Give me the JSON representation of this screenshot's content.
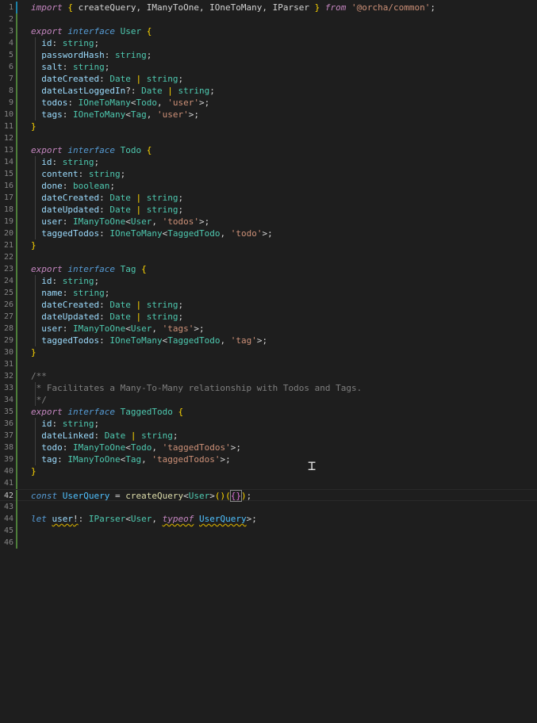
{
  "lines": [
    {
      "n": "1",
      "tokens": [
        [
          "kw",
          "import"
        ],
        [
          "op",
          " "
        ],
        [
          "br1",
          "{"
        ],
        [
          "op",
          " createQuery, IManyToOne, IOneToMany, IParser "
        ],
        [
          "br1",
          "}"
        ],
        [
          "op",
          " "
        ],
        [
          "kw",
          "from"
        ],
        [
          "op",
          " "
        ],
        [
          "str",
          "'@orcha/common'"
        ],
        [
          "op",
          ";"
        ]
      ]
    },
    {
      "n": "2",
      "tokens": []
    },
    {
      "n": "3",
      "tokens": [
        [
          "kw",
          "export"
        ],
        [
          "op",
          " "
        ],
        [
          "st",
          "interface"
        ],
        [
          "op",
          " "
        ],
        [
          "tp",
          "User"
        ],
        [
          "op",
          " "
        ],
        [
          "br1",
          "{"
        ]
      ]
    },
    {
      "n": "4",
      "tokens": [
        [
          "op",
          "  "
        ],
        [
          "pr",
          "id"
        ],
        [
          "op",
          ": "
        ],
        [
          "tp",
          "string"
        ],
        [
          "op",
          ";"
        ]
      ]
    },
    {
      "n": "5",
      "tokens": [
        [
          "op",
          "  "
        ],
        [
          "pr",
          "passwordHash"
        ],
        [
          "op",
          ": "
        ],
        [
          "tp",
          "string"
        ],
        [
          "op",
          ";"
        ]
      ]
    },
    {
      "n": "6",
      "tokens": [
        [
          "op",
          "  "
        ],
        [
          "pr",
          "salt"
        ],
        [
          "op",
          ": "
        ],
        [
          "tp",
          "string"
        ],
        [
          "op",
          ";"
        ]
      ]
    },
    {
      "n": "7",
      "tokens": [
        [
          "op",
          "  "
        ],
        [
          "pr",
          "dateCreated"
        ],
        [
          "op",
          ": "
        ],
        [
          "tp",
          "Date"
        ],
        [
          "op",
          " "
        ],
        [
          "bar",
          "|"
        ],
        [
          "op",
          " "
        ],
        [
          "tp",
          "string"
        ],
        [
          "op",
          ";"
        ]
      ]
    },
    {
      "n": "8",
      "tokens": [
        [
          "op",
          "  "
        ],
        [
          "pr",
          "dateLastLoggedIn"
        ],
        [
          "op",
          "?: "
        ],
        [
          "tp",
          "Date"
        ],
        [
          "op",
          " "
        ],
        [
          "bar",
          "|"
        ],
        [
          "op",
          " "
        ],
        [
          "tp",
          "string"
        ],
        [
          "op",
          ";"
        ]
      ]
    },
    {
      "n": "9",
      "tokens": [
        [
          "op",
          "  "
        ],
        [
          "pr",
          "todos"
        ],
        [
          "op",
          ": "
        ],
        [
          "tp",
          "IOneToMany"
        ],
        [
          "op",
          "<"
        ],
        [
          "tp",
          "Todo"
        ],
        [
          "op",
          ", "
        ],
        [
          "str",
          "'user'"
        ],
        [
          "op",
          ">;"
        ]
      ]
    },
    {
      "n": "10",
      "tokens": [
        [
          "op",
          "  "
        ],
        [
          "pr",
          "tags"
        ],
        [
          "op",
          ": "
        ],
        [
          "tp",
          "IOneToMany"
        ],
        [
          "op",
          "<"
        ],
        [
          "tp",
          "Tag"
        ],
        [
          "op",
          ", "
        ],
        [
          "str",
          "'user'"
        ],
        [
          "op",
          ">;"
        ]
      ]
    },
    {
      "n": "11",
      "tokens": [
        [
          "br1",
          "}"
        ]
      ]
    },
    {
      "n": "12",
      "tokens": []
    },
    {
      "n": "13",
      "tokens": [
        [
          "kw",
          "export"
        ],
        [
          "op",
          " "
        ],
        [
          "st",
          "interface"
        ],
        [
          "op",
          " "
        ],
        [
          "tp",
          "Todo"
        ],
        [
          "op",
          " "
        ],
        [
          "br1",
          "{"
        ]
      ]
    },
    {
      "n": "14",
      "tokens": [
        [
          "op",
          "  "
        ],
        [
          "pr",
          "id"
        ],
        [
          "op",
          ": "
        ],
        [
          "tp",
          "string"
        ],
        [
          "op",
          ";"
        ]
      ]
    },
    {
      "n": "15",
      "tokens": [
        [
          "op",
          "  "
        ],
        [
          "pr",
          "content"
        ],
        [
          "op",
          ": "
        ],
        [
          "tp",
          "string"
        ],
        [
          "op",
          ";"
        ]
      ]
    },
    {
      "n": "16",
      "tokens": [
        [
          "op",
          "  "
        ],
        [
          "pr",
          "done"
        ],
        [
          "op",
          ": "
        ],
        [
          "tp",
          "boolean"
        ],
        [
          "op",
          ";"
        ]
      ]
    },
    {
      "n": "17",
      "tokens": [
        [
          "op",
          "  "
        ],
        [
          "pr",
          "dateCreated"
        ],
        [
          "op",
          ": "
        ],
        [
          "tp",
          "Date"
        ],
        [
          "op",
          " "
        ],
        [
          "bar",
          "|"
        ],
        [
          "op",
          " "
        ],
        [
          "tp",
          "string"
        ],
        [
          "op",
          ";"
        ]
      ]
    },
    {
      "n": "18",
      "tokens": [
        [
          "op",
          "  "
        ],
        [
          "pr",
          "dateUpdated"
        ],
        [
          "op",
          ": "
        ],
        [
          "tp",
          "Date"
        ],
        [
          "op",
          " "
        ],
        [
          "bar",
          "|"
        ],
        [
          "op",
          " "
        ],
        [
          "tp",
          "string"
        ],
        [
          "op",
          ";"
        ]
      ]
    },
    {
      "n": "19",
      "tokens": [
        [
          "op",
          "  "
        ],
        [
          "pr",
          "user"
        ],
        [
          "op",
          ": "
        ],
        [
          "tp",
          "IManyToOne"
        ],
        [
          "op",
          "<"
        ],
        [
          "tp",
          "User"
        ],
        [
          "op",
          ", "
        ],
        [
          "str",
          "'todos'"
        ],
        [
          "op",
          ">;"
        ]
      ]
    },
    {
      "n": "20",
      "tokens": [
        [
          "op",
          "  "
        ],
        [
          "pr",
          "taggedTodos"
        ],
        [
          "op",
          ": "
        ],
        [
          "tp",
          "IOneToMany"
        ],
        [
          "op",
          "<"
        ],
        [
          "tp",
          "TaggedTodo"
        ],
        [
          "op",
          ", "
        ],
        [
          "str",
          "'todo'"
        ],
        [
          "op",
          ">;"
        ]
      ]
    },
    {
      "n": "21",
      "tokens": [
        [
          "br1",
          "}"
        ]
      ]
    },
    {
      "n": "22",
      "tokens": []
    },
    {
      "n": "23",
      "tokens": [
        [
          "kw",
          "export"
        ],
        [
          "op",
          " "
        ],
        [
          "st",
          "interface"
        ],
        [
          "op",
          " "
        ],
        [
          "tp",
          "Tag"
        ],
        [
          "op",
          " "
        ],
        [
          "br1",
          "{"
        ]
      ]
    },
    {
      "n": "24",
      "tokens": [
        [
          "op",
          "  "
        ],
        [
          "pr",
          "id"
        ],
        [
          "op",
          ": "
        ],
        [
          "tp",
          "string"
        ],
        [
          "op",
          ";"
        ]
      ]
    },
    {
      "n": "25",
      "tokens": [
        [
          "op",
          "  "
        ],
        [
          "pr",
          "name"
        ],
        [
          "op",
          ": "
        ],
        [
          "tp",
          "string"
        ],
        [
          "op",
          ";"
        ]
      ]
    },
    {
      "n": "26",
      "tokens": [
        [
          "op",
          "  "
        ],
        [
          "pr",
          "dateCreated"
        ],
        [
          "op",
          ": "
        ],
        [
          "tp",
          "Date"
        ],
        [
          "op",
          " "
        ],
        [
          "bar",
          "|"
        ],
        [
          "op",
          " "
        ],
        [
          "tp",
          "string"
        ],
        [
          "op",
          ";"
        ]
      ]
    },
    {
      "n": "27",
      "tokens": [
        [
          "op",
          "  "
        ],
        [
          "pr",
          "dateUpdated"
        ],
        [
          "op",
          ": "
        ],
        [
          "tp",
          "Date"
        ],
        [
          "op",
          " "
        ],
        [
          "bar",
          "|"
        ],
        [
          "op",
          " "
        ],
        [
          "tp",
          "string"
        ],
        [
          "op",
          ";"
        ]
      ]
    },
    {
      "n": "28",
      "tokens": [
        [
          "op",
          "  "
        ],
        [
          "pr",
          "user"
        ],
        [
          "op",
          ": "
        ],
        [
          "tp",
          "IManyToOne"
        ],
        [
          "op",
          "<"
        ],
        [
          "tp",
          "User"
        ],
        [
          "op",
          ", "
        ],
        [
          "str",
          "'tags'"
        ],
        [
          "op",
          ">;"
        ]
      ]
    },
    {
      "n": "29",
      "tokens": [
        [
          "op",
          "  "
        ],
        [
          "pr",
          "taggedTodos"
        ],
        [
          "op",
          ": "
        ],
        [
          "tp",
          "IOneToMany"
        ],
        [
          "op",
          "<"
        ],
        [
          "tp",
          "TaggedTodo"
        ],
        [
          "op",
          ", "
        ],
        [
          "str",
          "'tag'"
        ],
        [
          "op",
          ">;"
        ]
      ]
    },
    {
      "n": "30",
      "tokens": [
        [
          "br1",
          "}"
        ]
      ]
    },
    {
      "n": "31",
      "tokens": []
    },
    {
      "n": "32",
      "tokens": [
        [
          "cmg",
          "/**"
        ]
      ]
    },
    {
      "n": "33",
      "tokens": [
        [
          "cmg",
          " * Facilitates a Many-To-Many relationship with Todos and Tags."
        ]
      ]
    },
    {
      "n": "34",
      "tokens": [
        [
          "cmg",
          " */"
        ]
      ]
    },
    {
      "n": "35",
      "tokens": [
        [
          "kw",
          "export"
        ],
        [
          "op",
          " "
        ],
        [
          "st",
          "interface"
        ],
        [
          "op",
          " "
        ],
        [
          "tp",
          "TaggedTodo"
        ],
        [
          "op",
          " "
        ],
        [
          "br1",
          "{"
        ]
      ]
    },
    {
      "n": "36",
      "tokens": [
        [
          "op",
          "  "
        ],
        [
          "pr",
          "id"
        ],
        [
          "op",
          ": "
        ],
        [
          "tp",
          "string"
        ],
        [
          "op",
          ";"
        ]
      ]
    },
    {
      "n": "37",
      "tokens": [
        [
          "op",
          "  "
        ],
        [
          "pr",
          "dateLinked"
        ],
        [
          "op",
          ": "
        ],
        [
          "tp",
          "Date"
        ],
        [
          "op",
          " "
        ],
        [
          "bar",
          "|"
        ],
        [
          "op",
          " "
        ],
        [
          "tp",
          "string"
        ],
        [
          "op",
          ";"
        ]
      ]
    },
    {
      "n": "38",
      "tokens": [
        [
          "op",
          "  "
        ],
        [
          "pr",
          "todo"
        ],
        [
          "op",
          ": "
        ],
        [
          "tp",
          "IManyToOne"
        ],
        [
          "op",
          "<"
        ],
        [
          "tp",
          "Todo"
        ],
        [
          "op",
          ", "
        ],
        [
          "str",
          "'taggedTodos'"
        ],
        [
          "op",
          ">;"
        ]
      ]
    },
    {
      "n": "39",
      "tokens": [
        [
          "op",
          "  "
        ],
        [
          "pr",
          "tag"
        ],
        [
          "op",
          ": "
        ],
        [
          "tp",
          "IManyToOne"
        ],
        [
          "op",
          "<"
        ],
        [
          "tp",
          "Tag"
        ],
        [
          "op",
          ", "
        ],
        [
          "str",
          "'taggedTodos'"
        ],
        [
          "op",
          ">;"
        ]
      ]
    },
    {
      "n": "40",
      "tokens": [
        [
          "br1",
          "}"
        ]
      ]
    },
    {
      "n": "41",
      "tokens": []
    },
    {
      "n": "42",
      "current": true,
      "tokens": [
        [
          "st",
          "const"
        ],
        [
          "op",
          " "
        ],
        [
          "var",
          "UserQuery"
        ],
        [
          "op",
          " = "
        ],
        [
          "fn",
          "createQuery"
        ],
        [
          "op",
          "<"
        ],
        [
          "tp",
          "User"
        ],
        [
          "op",
          ">"
        ],
        [
          "br1",
          "()"
        ],
        [
          "br1",
          "("
        ],
        [
          "br2cur",
          "{}"
        ],
        [
          "br1",
          ")"
        ],
        [
          "op",
          ";"
        ]
      ]
    },
    {
      "n": "43",
      "tokens": []
    },
    {
      "n": "44",
      "tokens": [
        [
          "st",
          "let"
        ],
        [
          "op",
          " "
        ],
        [
          "pr squig",
          "user"
        ],
        [
          "op squig",
          "!"
        ],
        [
          "op",
          ": "
        ],
        [
          "tp",
          "IParser"
        ],
        [
          "op",
          "<"
        ],
        [
          "tp",
          "User"
        ],
        [
          "op",
          ", "
        ],
        [
          "kw squig",
          "typeof"
        ],
        [
          "op",
          " "
        ],
        [
          "var squig",
          "UserQuery"
        ],
        [
          "op",
          ">;"
        ]
      ]
    },
    {
      "n": "45",
      "tokens": []
    },
    {
      "n": "46",
      "tokens": []
    }
  ],
  "indented_lines": [
    "4",
    "5",
    "6",
    "7",
    "8",
    "9",
    "10",
    "14",
    "15",
    "16",
    "17",
    "18",
    "19",
    "20",
    "24",
    "25",
    "26",
    "27",
    "28",
    "29",
    "33",
    "34",
    "36",
    "37",
    "38",
    "39"
  ],
  "modified_lines": [
    "1",
    "2",
    "3",
    "4",
    "5",
    "6",
    "7",
    "8",
    "9",
    "10",
    "11",
    "12",
    "13",
    "14",
    "15",
    "16",
    "17",
    "18",
    "19",
    "20",
    "21",
    "22",
    "23",
    "24",
    "25",
    "26",
    "27",
    "28",
    "29",
    "30",
    "31",
    "32",
    "33",
    "34",
    "35",
    "36",
    "37",
    "38",
    "39",
    "40",
    "41",
    "42",
    "43",
    "44",
    "45",
    "46"
  ],
  "cursor_icon": "text-cursor-icon"
}
